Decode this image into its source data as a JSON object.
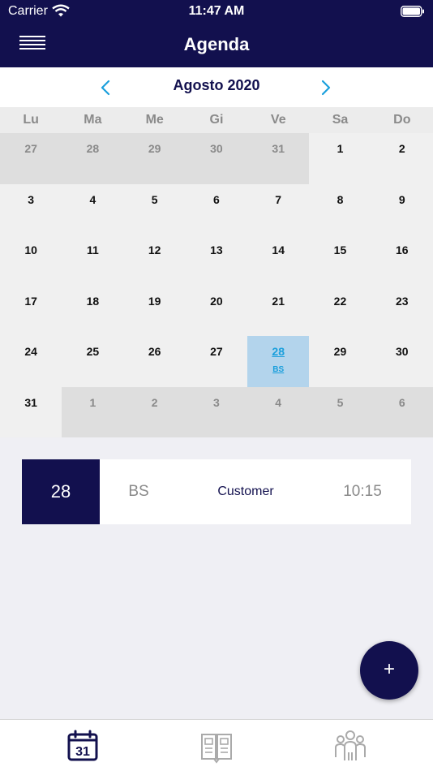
{
  "status_bar": {
    "carrier": "Carrier",
    "time": "11:47 AM"
  },
  "header": {
    "title": "Agenda"
  },
  "calendar": {
    "month_label": "Agosto 2020",
    "weekdays": [
      "Lu",
      "Ma",
      "Me",
      "Gi",
      "Ve",
      "Sa",
      "Do"
    ],
    "weeks": [
      [
        {
          "d": "27",
          "other": true
        },
        {
          "d": "28",
          "other": true
        },
        {
          "d": "29",
          "other": true
        },
        {
          "d": "30",
          "other": true
        },
        {
          "d": "31",
          "other": true
        },
        {
          "d": "1"
        },
        {
          "d": "2"
        }
      ],
      [
        {
          "d": "3"
        },
        {
          "d": "4"
        },
        {
          "d": "5"
        },
        {
          "d": "6"
        },
        {
          "d": "7"
        },
        {
          "d": "8"
        },
        {
          "d": "9"
        }
      ],
      [
        {
          "d": "10"
        },
        {
          "d": "11"
        },
        {
          "d": "12"
        },
        {
          "d": "13"
        },
        {
          "d": "14"
        },
        {
          "d": "15"
        },
        {
          "d": "16"
        }
      ],
      [
        {
          "d": "17"
        },
        {
          "d": "18"
        },
        {
          "d": "19"
        },
        {
          "d": "20"
        },
        {
          "d": "21"
        },
        {
          "d": "22"
        },
        {
          "d": "23"
        }
      ],
      [
        {
          "d": "24"
        },
        {
          "d": "25"
        },
        {
          "d": "26"
        },
        {
          "d": "27"
        },
        {
          "d": "28",
          "selected": true,
          "event": "BS"
        },
        {
          "d": "29"
        },
        {
          "d": "30"
        }
      ],
      [
        {
          "d": "31"
        },
        {
          "d": "1",
          "other": true
        },
        {
          "d": "2",
          "other": true
        },
        {
          "d": "3",
          "other": true
        },
        {
          "d": "4",
          "other": true
        },
        {
          "d": "5",
          "other": true
        },
        {
          "d": "6",
          "other": true
        }
      ]
    ]
  },
  "appointment": {
    "day": "28",
    "code": "BS",
    "client": "Customer",
    "time": "10:15"
  },
  "fab": {
    "label": "+"
  },
  "tabbar": {
    "agenda_icon_number": "31"
  },
  "icons": [
    "wifi-icon",
    "battery-icon",
    "menu-icon",
    "chevron-left-icon",
    "chevron-right-icon",
    "calendar-icon",
    "catalog-icon",
    "clients-icon"
  ],
  "colors": {
    "navy": "#12104e",
    "accent": "#1a9fdc",
    "selected_bg": "#b3d4ec"
  }
}
